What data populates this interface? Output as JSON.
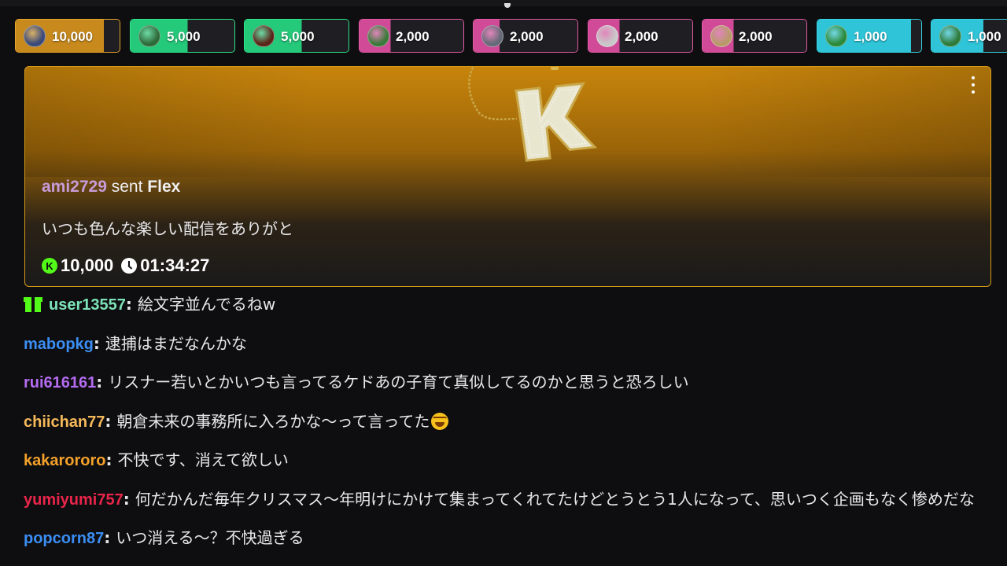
{
  "tips": [
    {
      "amount": "10,000",
      "border": "#e8a52b",
      "fill": "#c88a1d",
      "avatar": "#3a4a7a"
    },
    {
      "amount": "5,000",
      "border": "#2ee88a",
      "fill": "#25c97a",
      "avatar": "#2f6b3a"
    },
    {
      "amount": "5,000",
      "border": "#2ee88a",
      "fill": "#25c97a",
      "avatar": "#5a2418"
    },
    {
      "amount": "2,000",
      "border": "#e35aa5",
      "fill": "#d14a98",
      "avatar": "#3b7a3a"
    },
    {
      "amount": "2,000",
      "border": "#e35aa5",
      "fill": "#d14a98",
      "avatar": "#666a78"
    },
    {
      "amount": "2,000",
      "border": "#e35aa5",
      "fill": "#d14a98",
      "avatar": "#c8c8c8"
    },
    {
      "amount": "2,000",
      "border": "#e35aa5",
      "fill": "#d14a98",
      "avatar": "#b89a6a"
    },
    {
      "amount": "1,000",
      "border": "#35d6e6",
      "fill": "#2fc4d8",
      "avatar": "#2c8a3a"
    },
    {
      "amount": "1,000",
      "border": "#35d6e6",
      "fill": "#2fc4d8",
      "avatar": "#2f7a3a"
    }
  ],
  "flex": {
    "username": "ami2729",
    "sent_word": "sent",
    "gift": "Flex",
    "message": "いつも色んな楽しい配信をありがと",
    "amount": "10,000",
    "time": "01:34:27",
    "kick_icon_letter": "K"
  },
  "chat": [
    {
      "user": "user13557",
      "color": "#7de3b8",
      "text": "絵文字並んでるねw",
      "badge": "gift-icon"
    },
    {
      "user": "mabopkg",
      "color": "#3b8ef3",
      "text": "逮捕はまだなんかな"
    },
    {
      "user": "rui616161",
      "color": "#b36bf0",
      "text": "リスナー若いとかいつも言ってるケドあの子育て真似してるのかと思うと恐ろしい"
    },
    {
      "user": "chiichan77",
      "color": "#f5b95a",
      "text": "朝倉未来の事務所に入ろかな〜って言ってた",
      "emoji": "rofl-emoji"
    },
    {
      "user": "kakarororo",
      "color": "#f5a22a",
      "text": "不快です、消えて欲しい"
    },
    {
      "user": "yumiyumi757",
      "color": "#e8254a",
      "text": "何だかんだ毎年クリスマス〜年明けにかけて集まってくれてたけどとうとう1人になって、思いつく企画もなく惨めだな"
    },
    {
      "user": "popcorn87",
      "color": "#3b8ef3",
      "text": "いつ消える〜？不快過ぎる"
    }
  ]
}
